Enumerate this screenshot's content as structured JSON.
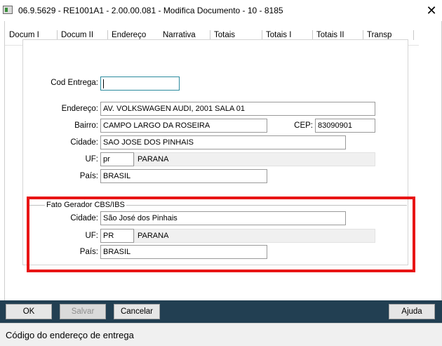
{
  "window": {
    "title": "06.9.5629 - RE1001A1 - 2.00.00.081 - Modifica Documento - 10 - 8185",
    "close_symbol": "✕"
  },
  "tabs": [
    {
      "label": "Docum I"
    },
    {
      "label": "Docum II"
    },
    {
      "label": "Endereço",
      "active": true
    },
    {
      "label": "Narrativa"
    },
    {
      "label": "Totais"
    },
    {
      "label": "Totais I"
    },
    {
      "label": "Totais II"
    },
    {
      "label": "Transp"
    }
  ],
  "form": {
    "cod_entrega": {
      "label": "Cod Entrega:",
      "value": ""
    },
    "endereco": {
      "label": "Endereço:",
      "value": "AV. VOLKSWAGEN AUDI, 2001 SALA 01"
    },
    "bairro": {
      "label": "Bairro:",
      "value": "CAMPO LARGO DA ROSEIRA"
    },
    "cep": {
      "label": "CEP:",
      "value": "83090901"
    },
    "cidade": {
      "label": "Cidade:",
      "value": "SAO JOSE DOS PINHAIS"
    },
    "uf": {
      "label": "UF:",
      "value": "pr",
      "description": "PARANA"
    },
    "pais": {
      "label": "País:",
      "value": "BRASIL"
    }
  },
  "fato_gerador": {
    "title": "Fato Gerador CBS/IBS",
    "cidade": {
      "label": "Cidade:",
      "value": "São José dos Pinhais"
    },
    "uf": {
      "label": "UF:",
      "value": "PR",
      "description": "PARANA"
    },
    "pais": {
      "label": "País:",
      "value": "BRASIL"
    }
  },
  "buttons": {
    "ok": "OK",
    "salvar": "Salvar",
    "cancelar": "Cancelar",
    "ajuda": "Ajuda"
  },
  "status_bar": {
    "text": "Código do endereço de entrega"
  },
  "colors": {
    "highlight": "#e81515",
    "footer": "#223f52",
    "tab_underline": "#1f8fd6"
  }
}
